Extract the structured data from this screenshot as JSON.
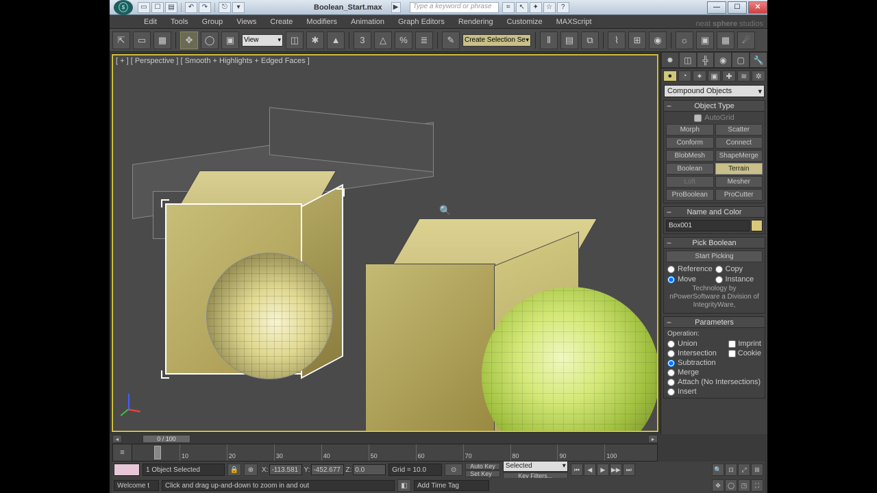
{
  "title": "Boolean_Start.max",
  "search_placeholder": "Type a keyword or phrase",
  "menus": [
    "Edit",
    "Tools",
    "Group",
    "Views",
    "Create",
    "Modifiers",
    "Animation",
    "Graph Editors",
    "Rendering",
    "Customize",
    "MAXScript"
  ],
  "watermark_a": "neat ",
  "watermark_b": "sphere",
  "watermark_c": " studios",
  "toolbar": {
    "view_select": "View",
    "named_sel": "Create Selection Se"
  },
  "viewport_label": "[ + ] [ Perspective ] [ Smooth + Highlights + Edged Faces ]",
  "cmd": {
    "category": "Compound Objects",
    "object_type_title": "Object Type",
    "autogrid": "AutoGrid",
    "buttons": [
      "Morph",
      "Scatter",
      "Conform",
      "Connect",
      "BlobMesh",
      "ShapeMerge",
      "Boolean",
      "Terrain",
      "Loft",
      "Mesher",
      "ProBoolean",
      "ProCutter"
    ],
    "terrain_pressed_index": 7,
    "name_color_title": "Name and Color",
    "object_name": "Box001",
    "pick_title": "Pick Boolean",
    "start_picking": "Start Picking",
    "pick_opts": [
      "Reference",
      "Copy",
      "Move",
      "Instance"
    ],
    "tech": "Technology by nPowerSoftware a Division of IntegrityWare,",
    "params_title": "Parameters",
    "operation_label": "Operation:",
    "ops": [
      "Union",
      "Intersection",
      "Subtraction",
      "Merge",
      "Attach (No Intersections)",
      "Insert"
    ],
    "imprint": "Imprint",
    "cookie": "Cookie"
  },
  "time": {
    "frame": "0 / 100",
    "ticks": [
      "10",
      "20",
      "30",
      "40",
      "50",
      "60",
      "70",
      "80",
      "90",
      "100"
    ]
  },
  "status": {
    "sel": "1 Object Selected",
    "x": "-113.581",
    "y": "-452.677",
    "z": "0.0",
    "grid": "Grid = 10.0",
    "autokey": "Auto Key",
    "sel_mode": "Selected",
    "setkey": "Set Key",
    "filters": "Key Filters..."
  },
  "prompt": {
    "welcome": "Welcome t",
    "hint": "Click and drag up-and-down to zoom in and out",
    "timetag": "Add Time Tag"
  }
}
